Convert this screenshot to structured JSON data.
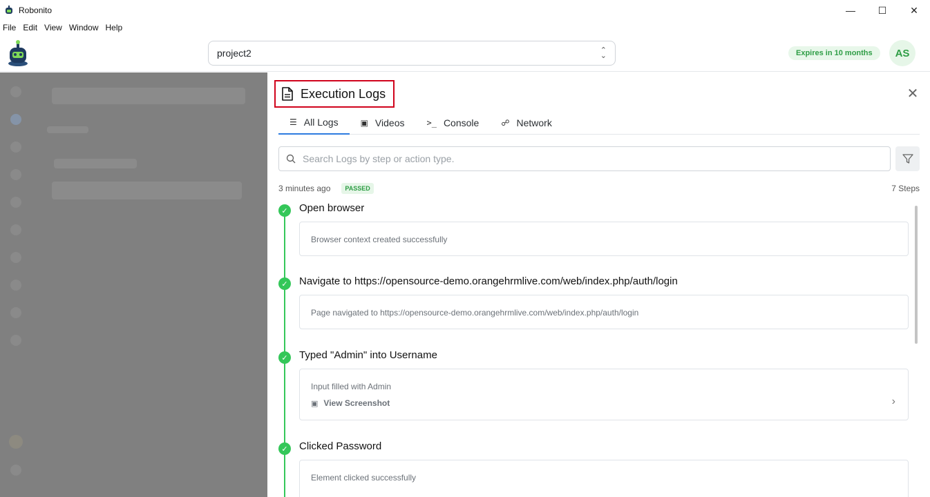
{
  "window": {
    "title": "Robonito",
    "controls": [
      "minimize",
      "maximize",
      "close"
    ]
  },
  "menu": [
    "File",
    "Edit",
    "View",
    "Window",
    "Help"
  ],
  "header": {
    "project_value": "project2",
    "expires_label": "Expires in 10 months",
    "avatar_initials": "AS"
  },
  "panel": {
    "title": "Execution Logs",
    "tabs": [
      {
        "label": "All Logs",
        "icon": "list-icon",
        "active": true
      },
      {
        "label": "Videos",
        "icon": "video-icon",
        "active": false
      },
      {
        "label": "Console",
        "icon": "terminal-icon",
        "active": false
      },
      {
        "label": "Network",
        "icon": "network-icon",
        "active": false
      }
    ],
    "search_placeholder": "Search Logs by step or action type.",
    "run_time": "3 minutes ago",
    "status": "PASSED",
    "steps_count": "7 Steps",
    "steps": [
      {
        "title": "Open browser",
        "message": "Browser context created successfully"
      },
      {
        "title": "Navigate to https://opensource-demo.orangehrmlive.com/web/index.php/auth/login",
        "message": "Page navigated to https://opensource-demo.orangehrmlive.com/web/index.php/auth/login"
      },
      {
        "title": "Typed \"Admin\" into Username",
        "message": "Input filled with Admin",
        "screenshot_label": "View Screenshot"
      },
      {
        "title": "Clicked Password",
        "message": "Element clicked successfully"
      }
    ]
  },
  "colors": {
    "accent": "#2d7be0",
    "success": "#34c759",
    "highlight": "#d0021b"
  }
}
